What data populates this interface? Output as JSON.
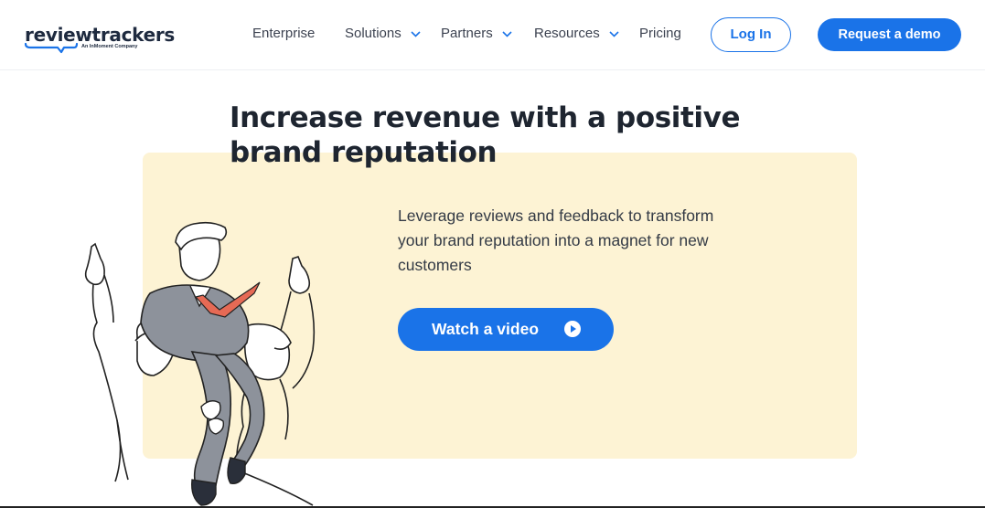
{
  "brand": {
    "name": "reviewtrackers",
    "tagline": "An InMoment Company",
    "accent": "#1a73e8",
    "hero_bg": "#fdf3d4"
  },
  "nav": {
    "items": [
      {
        "label": "Enterprise",
        "has_dropdown": false
      },
      {
        "label": "Solutions",
        "has_dropdown": true
      },
      {
        "label": "Partners",
        "has_dropdown": true
      },
      {
        "label": "Resources",
        "has_dropdown": true
      },
      {
        "label": "Pricing",
        "has_dropdown": false
      }
    ],
    "login_label": "Log In",
    "demo_label": "Request a demo"
  },
  "hero": {
    "title": "Increase revenue with a positive brand reputation",
    "subtitle": "Leverage reviews and feedback to transform your brand reputation into a magnet for new customers",
    "video_button_label": "Watch a video",
    "video_icon": "play-circle-icon",
    "illustration": "celebrating-people-illustration"
  }
}
